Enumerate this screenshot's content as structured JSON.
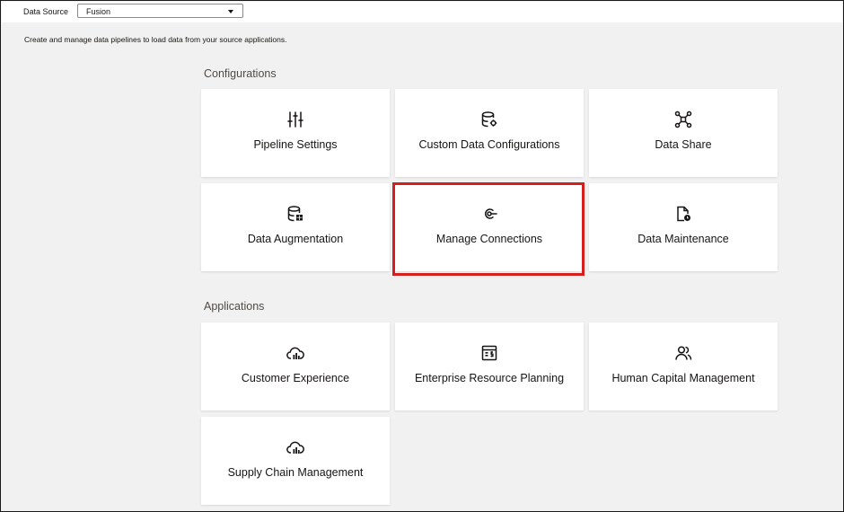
{
  "topbar": {
    "data_source_label": "Data Source",
    "data_source_value": "Fusion"
  },
  "description": "Create and manage data pipelines to load data from your source applications.",
  "configurations": {
    "title": "Configurations",
    "cards": [
      {
        "label": "Pipeline Settings",
        "icon": "sliders-icon"
      },
      {
        "label": "Custom Data Configurations",
        "icon": "database-gear-icon"
      },
      {
        "label": "Data Share",
        "icon": "share-network-icon"
      },
      {
        "label": "Data Augmentation",
        "icon": "database-table-icon"
      },
      {
        "label": "Manage Connections",
        "icon": "connection-icon"
      },
      {
        "label": "Data Maintenance",
        "icon": "document-clock-icon"
      }
    ]
  },
  "applications": {
    "title": "Applications",
    "cards": [
      {
        "label": "Customer Experience",
        "icon": "cloud-chart-icon"
      },
      {
        "label": "Enterprise Resource Planning",
        "icon": "finance-report-icon"
      },
      {
        "label": "Human Capital Management",
        "icon": "users-icon"
      },
      {
        "label": "Supply Chain Management",
        "icon": "cloud-chart-icon"
      }
    ]
  },
  "colors": {
    "highlight": "#d41f1f",
    "background": "#f1f1f1",
    "card": "#ffffff"
  }
}
